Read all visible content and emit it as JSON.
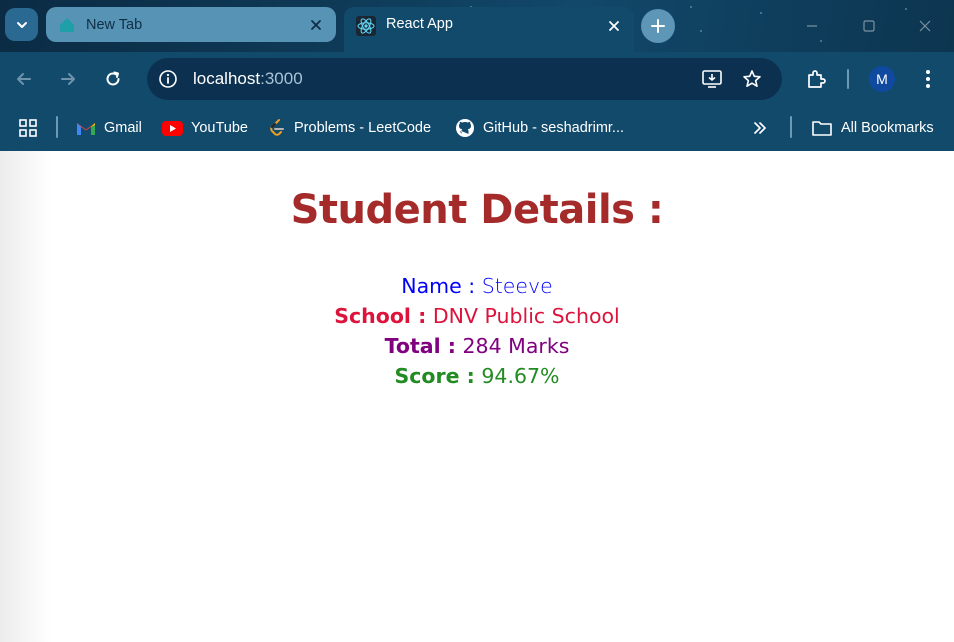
{
  "browser": {
    "tabs": [
      {
        "label": "New Tab",
        "active": false
      },
      {
        "label": "React App",
        "active": true
      }
    ],
    "address": {
      "host": "localhost",
      "port": ":3000"
    },
    "bookmarks": [
      {
        "label": "Gmail",
        "icon": "gmail-icon"
      },
      {
        "label": "YouTube",
        "icon": "youtube-icon"
      },
      {
        "label": "Problems - LeetCode",
        "icon": "leetcode-icon"
      },
      {
        "label": "GitHub - seshadrimr...",
        "icon": "github-icon"
      }
    ],
    "all_bookmarks_label": "All Bookmarks",
    "profile_initial": "M"
  },
  "page": {
    "title": "Student Details :",
    "fields": [
      {
        "label": "Name :",
        "value": "Steeve",
        "color": "#0000ff"
      },
      {
        "label": "School :",
        "value": "DNV Public School",
        "color": "#dc143c"
      },
      {
        "label": "Total :",
        "value": "284 Marks",
        "color": "#800080"
      },
      {
        "label": "Score :",
        "value": "94.67%",
        "color": "#228b22"
      }
    ],
    "title_color": "#a52a2a"
  }
}
